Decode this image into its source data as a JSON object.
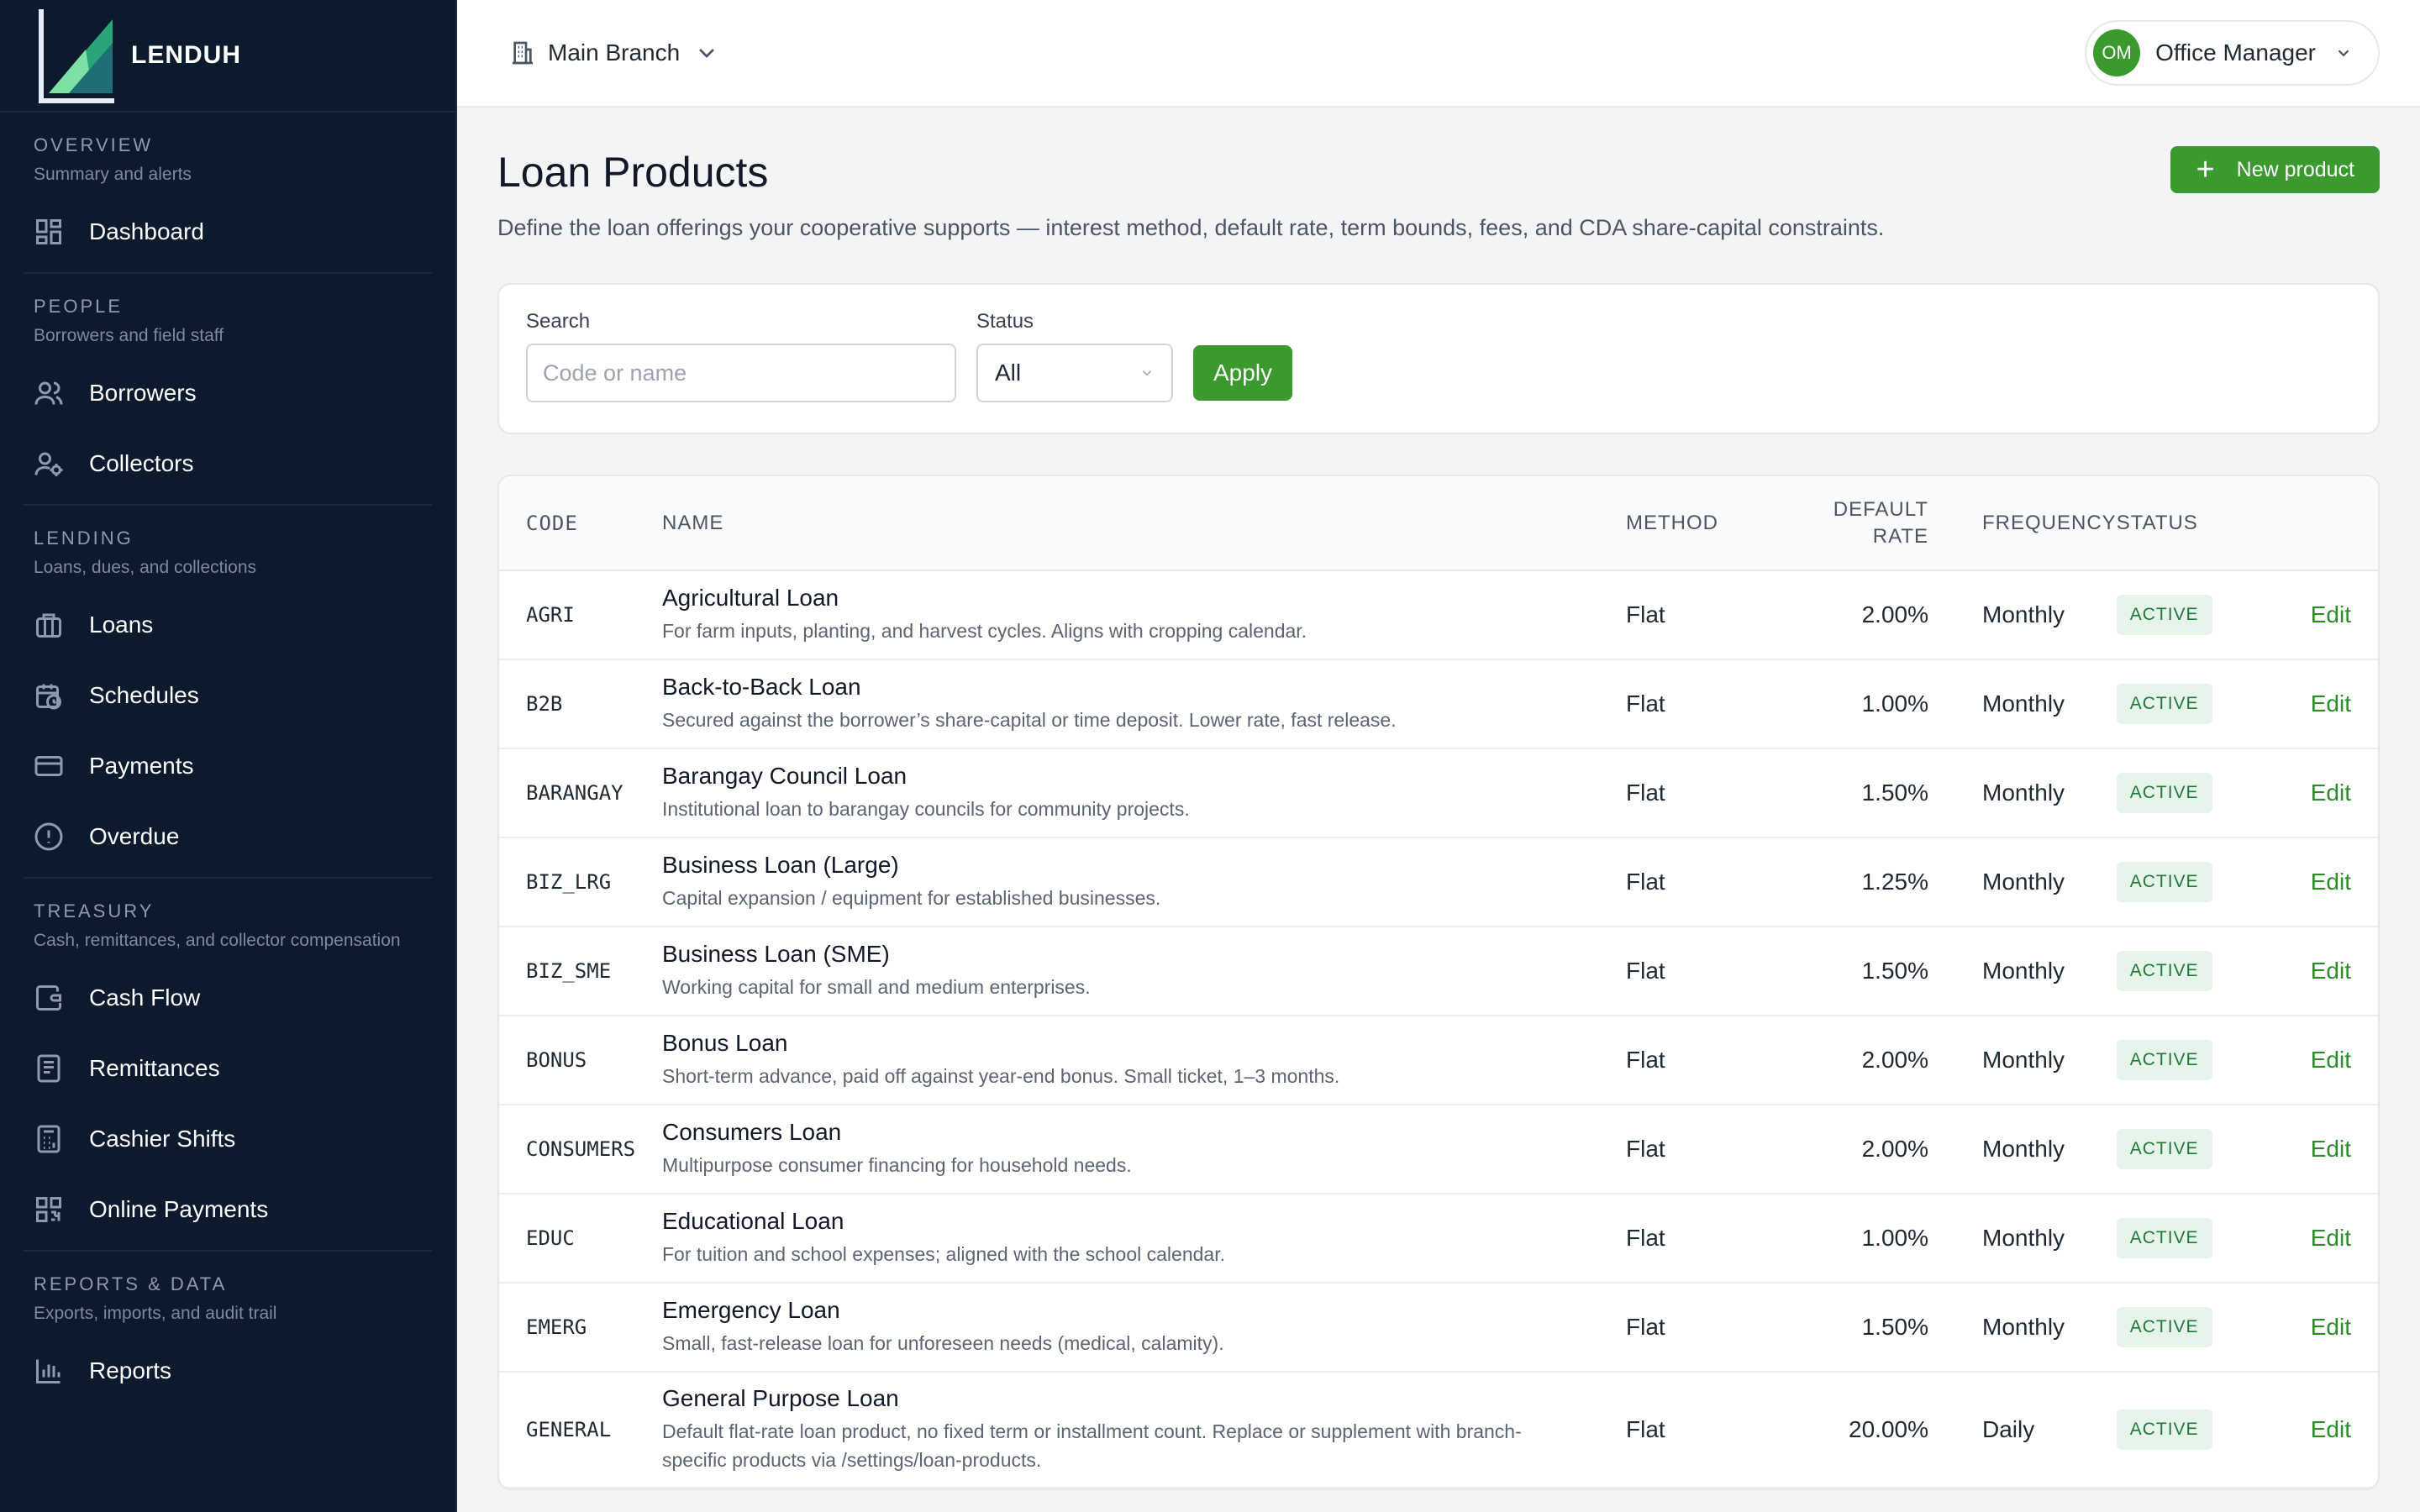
{
  "brand": {
    "name": "LENDUH"
  },
  "sidebar": {
    "sections": [
      {
        "title": "OVERVIEW",
        "subtitle": "Summary and alerts",
        "items": [
          {
            "label": "Dashboard",
            "icon": "grid-icon"
          }
        ]
      },
      {
        "title": "PEOPLE",
        "subtitle": "Borrowers and field staff",
        "items": [
          {
            "label": "Borrowers",
            "icon": "users-icon"
          },
          {
            "label": "Collectors",
            "icon": "user-gear-icon"
          }
        ]
      },
      {
        "title": "LENDING",
        "subtitle": "Loans, dues, and collections",
        "items": [
          {
            "label": "Loans",
            "icon": "briefcase-icon"
          },
          {
            "label": "Schedules",
            "icon": "calendar-clock-icon"
          },
          {
            "label": "Payments",
            "icon": "credit-card-icon"
          },
          {
            "label": "Overdue",
            "icon": "alert-circle-icon"
          }
        ]
      },
      {
        "title": "TREASURY",
        "subtitle": "Cash, remittances, and collector compensation",
        "items": [
          {
            "label": "Cash Flow",
            "icon": "wallet-icon"
          },
          {
            "label": "Remittances",
            "icon": "receipt-icon"
          },
          {
            "label": "Cashier Shifts",
            "icon": "calculator-icon"
          },
          {
            "label": "Online Payments",
            "icon": "qr-code-icon"
          }
        ]
      },
      {
        "title": "REPORTS & DATA",
        "subtitle": "Exports, imports, and audit trail",
        "items": [
          {
            "label": "Reports",
            "icon": "bar-chart-icon"
          }
        ]
      }
    ]
  },
  "header": {
    "branch": "Main Branch",
    "user_initials": "OM",
    "user_role": "Office Manager"
  },
  "page": {
    "title": "Loan Products",
    "subtitle": "Define the loan offerings your cooperative supports — interest method, default rate, term bounds, fees, and CDA share-capital constraints.",
    "new_button": "New product"
  },
  "filters": {
    "search_label": "Search",
    "search_placeholder": "Code or name",
    "status_label": "Status",
    "status_value": "All",
    "apply_label": "Apply"
  },
  "table": {
    "headers": {
      "code": "CODE",
      "name": "NAME",
      "method": "METHOD",
      "rate_1": "DEFAULT",
      "rate_2": "RATE",
      "frequency": "FREQUENCY",
      "status": "STATUS"
    },
    "rows": [
      {
        "code": "AGRI",
        "name": "Agricultural Loan",
        "desc": "For farm inputs, planting, and harvest cycles. Aligns with cropping calendar.",
        "method": "Flat",
        "rate": "2.00%",
        "frequency": "Monthly",
        "status": "ACTIVE",
        "action": "Edit"
      },
      {
        "code": "B2B",
        "name": "Back-to-Back Loan",
        "desc": "Secured against the borrower’s share-capital or time deposit. Lower rate, fast release.",
        "method": "Flat",
        "rate": "1.00%",
        "frequency": "Monthly",
        "status": "ACTIVE",
        "action": "Edit"
      },
      {
        "code": "BARANGAY",
        "name": "Barangay Council Loan",
        "desc": "Institutional loan to barangay councils for community projects.",
        "method": "Flat",
        "rate": "1.50%",
        "frequency": "Monthly",
        "status": "ACTIVE",
        "action": "Edit"
      },
      {
        "code": "BIZ_LRG",
        "name": "Business Loan (Large)",
        "desc": "Capital expansion / equipment for established businesses.",
        "method": "Flat",
        "rate": "1.25%",
        "frequency": "Monthly",
        "status": "ACTIVE",
        "action": "Edit"
      },
      {
        "code": "BIZ_SME",
        "name": "Business Loan (SME)",
        "desc": "Working capital for small and medium enterprises.",
        "method": "Flat",
        "rate": "1.50%",
        "frequency": "Monthly",
        "status": "ACTIVE",
        "action": "Edit"
      },
      {
        "code": "BONUS",
        "name": "Bonus Loan",
        "desc": "Short-term advance, paid off against year-end bonus. Small ticket, 1–3 months.",
        "method": "Flat",
        "rate": "2.00%",
        "frequency": "Monthly",
        "status": "ACTIVE",
        "action": "Edit"
      },
      {
        "code": "CONSUMERS",
        "name": "Consumers Loan",
        "desc": "Multipurpose consumer financing for household needs.",
        "method": "Flat",
        "rate": "2.00%",
        "frequency": "Monthly",
        "status": "ACTIVE",
        "action": "Edit"
      },
      {
        "code": "EDUC",
        "name": "Educational Loan",
        "desc": "For tuition and school expenses; aligned with the school calendar.",
        "method": "Flat",
        "rate": "1.00%",
        "frequency": "Monthly",
        "status": "ACTIVE",
        "action": "Edit"
      },
      {
        "code": "EMERG",
        "name": "Emergency Loan",
        "desc": "Small, fast-release loan for unforeseen needs (medical, calamity).",
        "method": "Flat",
        "rate": "1.50%",
        "frequency": "Monthly",
        "status": "ACTIVE",
        "action": "Edit"
      },
      {
        "code": "GENERAL",
        "name": "General Purpose Loan",
        "desc": "Default flat-rate loan product, no fixed term or installment count. Replace or supplement with branch-specific products via /settings/loan-products.",
        "method": "Flat",
        "rate": "20.00%",
        "frequency": "Daily",
        "status": "ACTIVE",
        "action": "Edit"
      }
    ]
  },
  "colors": {
    "sidebar_bg": "#0c1a2e",
    "accent_green": "#3a9a2e",
    "badge_bg": "#e7f4ea"
  }
}
